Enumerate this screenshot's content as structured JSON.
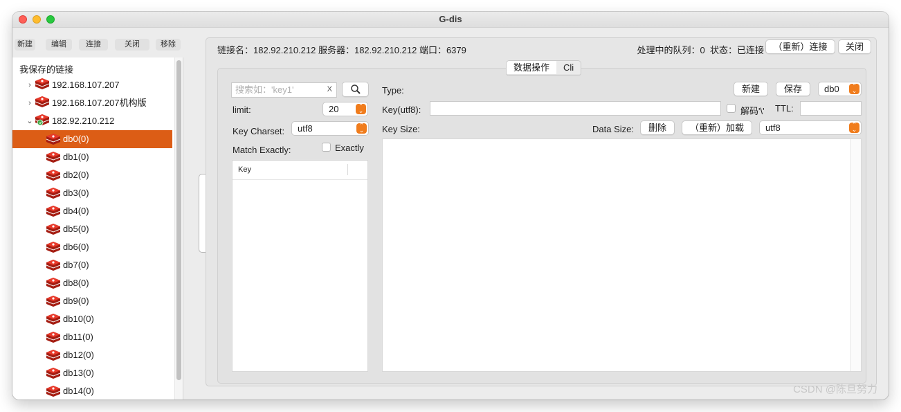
{
  "window": {
    "title": "G-dis"
  },
  "left_toolbar": {
    "new": "新建",
    "edit": "编辑",
    "connect": "连接",
    "close": "关闭",
    "remove": "移除"
  },
  "tree": {
    "header": "我保存的链接",
    "connections": [
      {
        "label": "192.168.107.207",
        "expanded": false
      },
      {
        "label": "192.168.107.207机构版",
        "expanded": false
      },
      {
        "label": "182.92.210.212",
        "expanded": true
      }
    ],
    "databases": [
      "db0(0)",
      "db1(0)",
      "db2(0)",
      "db3(0)",
      "db4(0)",
      "db5(0)",
      "db6(0)",
      "db7(0)",
      "db8(0)",
      "db9(0)",
      "db10(0)",
      "db11(0)",
      "db12(0)",
      "db13(0)",
      "db14(0)"
    ],
    "selected": "db0(0)"
  },
  "info_bar": {
    "connection_text": "链接名：182.92.210.212 服务器：182.92.210.212 端口：6379",
    "queue_text": "处理中的队列：0",
    "status_text": "状态：已连接",
    "reconnect_button": "（重新）连接",
    "close_button": "关闭"
  },
  "tabs": [
    {
      "label": "数据操作",
      "active": true
    },
    {
      "label": "Cli",
      "active": false
    }
  ],
  "key_panel": {
    "search_placeholder": "搜索如：'key1'",
    "clear_glyph": "X",
    "limit_label": "limit:",
    "limit_value": "20",
    "charset_label": "Key Charset:",
    "charset_value": "utf8",
    "match_label": "Match Exactly:",
    "exactly_label": "Exactly",
    "list_header": "Key"
  },
  "value_panel": {
    "type_label": "Type:",
    "new_button": "新建",
    "save_button": "保存",
    "db_value": "db0",
    "key_label": "Key(utf8):",
    "decode_label": "解码'\\'",
    "ttl_label": "TTL:",
    "keysize_label": "Key Size:",
    "datasize_label": "Data Size:",
    "delete_button": "删除",
    "reload_button": "（重新）加载",
    "encoding_value": "utf8"
  },
  "colors": {
    "accent": "#dc5d16",
    "stepper": "#f07c1c",
    "redis_red": "#d42b1e"
  },
  "watermark": "CSDN @陈旦努力"
}
